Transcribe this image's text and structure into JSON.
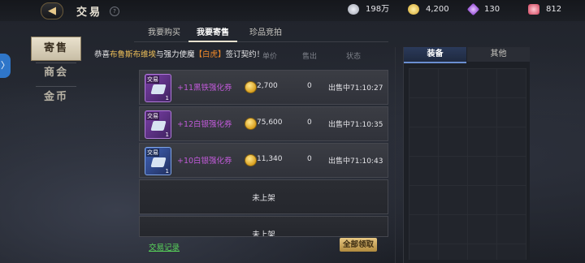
{
  "header": {
    "back_icon": "back-arrow-icon",
    "title": "交易",
    "help_label": "?"
  },
  "currencies": [
    {
      "icon": "silver-ingot-icon",
      "value": "198万",
      "color": "#c9ccd6"
    },
    {
      "icon": "gold-coin-icon",
      "value": "4,200",
      "color": "#e6c14a"
    },
    {
      "icon": "purple-gem-icon",
      "value": "130",
      "color": "#b56ee8"
    },
    {
      "icon": "red-gem-icon",
      "value": "812",
      "color": "#e05a6a"
    }
  ],
  "side_tab_label": "〉",
  "side_nav": [
    "寄售",
    "商会",
    "金币"
  ],
  "tabs": [
    "我要购买",
    "我要寄售",
    "珍品竞拍"
  ],
  "notice": {
    "prefix": "恭喜",
    "player": "布鲁斯布维埃",
    "middle": "与强力使魔",
    "beast": "【白虎】",
    "suffix": "签订契约！"
  },
  "headers": {
    "price": "单价",
    "sold": "售出",
    "status": "状态"
  },
  "listings": [
    {
      "badge": "交易",
      "level": "+11",
      "qty": "1",
      "name": "+11黑铁强化券",
      "price": "2,700",
      "sold": "0",
      "status": "出售中71:10:27",
      "icon_color": "purple"
    },
    {
      "badge": "交易",
      "level": "+12",
      "qty": "1",
      "name": "+12白银强化券",
      "price": "75,600",
      "sold": "0",
      "status": "出售中71:10:35",
      "icon_color": "purple"
    },
    {
      "badge": "交易",
      "level": "+10",
      "qty": "1",
      "name": "+10白银强化券",
      "price": "11,340",
      "sold": "0",
      "status": "出售中71:10:43",
      "icon_color": "blue"
    }
  ],
  "empty_slot_label": "未上架",
  "records_link": "交易记录",
  "claim_all": "全部领取",
  "right_tabs": [
    "装备",
    "其他"
  ]
}
